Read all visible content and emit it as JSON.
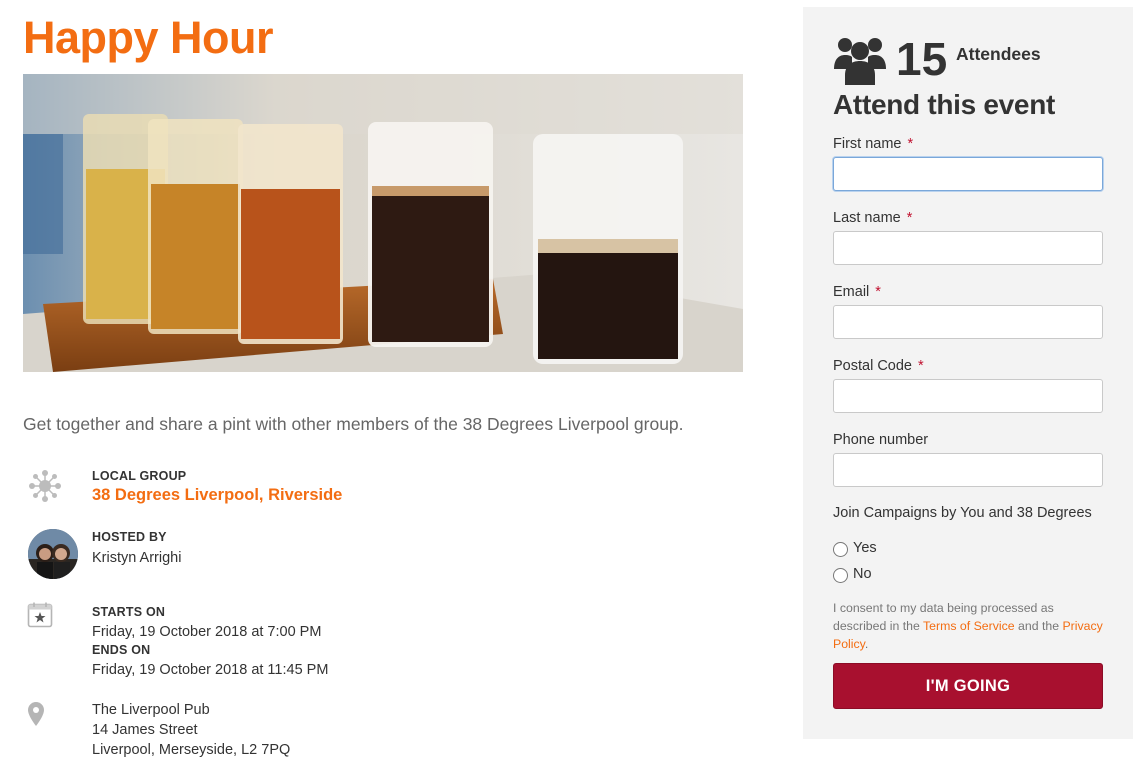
{
  "event": {
    "title": "Happy Hour",
    "description": "Get together and share a pint with other members of the 38 Degrees Liverpool group."
  },
  "details": {
    "group_label": "LOCAL GROUP",
    "group_name": "38 Degrees Liverpool, Riverside",
    "host_label": "HOSTED BY",
    "host_name": "Kristyn Arrighi",
    "starts_label": "STARTS ON",
    "starts_value": "Friday, 19 October 2018 at 7:00 PM",
    "ends_label": "ENDS ON",
    "ends_value": "Friday, 19 October 2018 at 11:45 PM",
    "venue": "The Liverpool Pub",
    "street": "14 James Street",
    "city": "Liverpool, Merseyside, L2 7PQ"
  },
  "rsvp": {
    "attendee_count": "15",
    "attendee_label": "Attendees",
    "heading": "Attend this event",
    "fields": [
      {
        "label": "First name",
        "required": "*",
        "value": ""
      },
      {
        "label": "Last name",
        "required": "*",
        "value": ""
      },
      {
        "label": "Email",
        "required": "*",
        "value": ""
      },
      {
        "label": "Postal Code",
        "required": "*",
        "value": ""
      },
      {
        "label": "Phone number",
        "required": "",
        "value": ""
      }
    ],
    "join_question": "Join Campaigns by You and 38 Degrees",
    "options": [
      "Yes",
      "No"
    ],
    "consent_prefix": "I consent to my data being processed as described in the ",
    "terms_link": "Terms of Service",
    "consent_mid": " and the ",
    "privacy_link": "Privacy Policy",
    "consent_suffix": ".",
    "submit_label": "I'M GOING"
  },
  "colors": {
    "accent": "#f36d12",
    "button": "#a8102f",
    "panel": "#f3f3f3"
  },
  "icons": [
    "network-icon",
    "calendar-star-icon",
    "map-pin-icon",
    "users-icon"
  ]
}
